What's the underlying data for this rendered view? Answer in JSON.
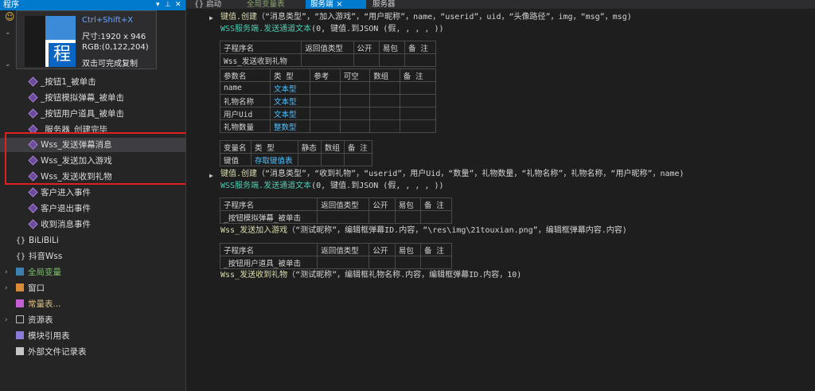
{
  "left_panel": {
    "title": "程序",
    "pin_icon": "pin-icon",
    "close_icon": "close-icon",
    "tree": [
      {
        "label": "_按钮1_被单击"
      },
      {
        "label": "_按钮模拟弹幕_被单击"
      },
      {
        "label": "_按钮用户道具_被单击"
      },
      {
        "label": "_服务器_创建完毕"
      },
      {
        "label": "Wss_发送弹幕消息"
      },
      {
        "label": "Wss_发送加入游戏"
      },
      {
        "label": "Wss_发送收到礼物"
      },
      {
        "label": "客户进入事件"
      },
      {
        "label": "客户退出事件"
      },
      {
        "label": "收到消息事件"
      },
      {
        "label": "BiLiBiLi"
      },
      {
        "label": "抖音Wss"
      },
      {
        "label": "全局变量"
      },
      {
        "label": "窗口"
      },
      {
        "label": "常量表..."
      },
      {
        "label": "资源表"
      },
      {
        "label": "模块引用表"
      },
      {
        "label": "外部文件记录表"
      }
    ]
  },
  "tooltip": {
    "hotkey": "Ctrl+Shift+X",
    "size": "尺寸:1920 x 946",
    "rgb": "RGB:(0,122,204)",
    "hint": "双击可完成复制",
    "thumb_char": "程"
  },
  "tabs": [
    {
      "label": "启动",
      "icon": "braces-icon"
    },
    {
      "label": "全局变量表"
    },
    {
      "label": "服务端",
      "close": "×"
    },
    {
      "label": "服务器"
    }
  ],
  "editor": {
    "line1": {
      "fn": "键值.创建",
      "args": "（“消息类型”，“加入游戏”，“用户昵称”，name，“userid”，uid，“头像路径”，img，“msg”，msg)"
    },
    "line2": {
      "fn": "WSS服务端.发送通道文本",
      "args": "(0, 键值.到JSON (假, , , , ))"
    },
    "table1": {
      "header": [
        "子程序名",
        "返回值类型",
        "公开",
        "易包",
        "备 注"
      ],
      "row": [
        "Wss_发送收到礼物",
        "",
        "",
        "",
        ""
      ],
      "param_header": [
        "参数名",
        "类 型",
        "参考",
        "可空",
        "数组",
        "备 注"
      ],
      "params": [
        [
          "name",
          "文本型",
          "",
          "",
          "",
          ""
        ],
        [
          "礼物名称",
          "文本型",
          "",
          "",
          "",
          ""
        ],
        [
          "用户Uid",
          "文本型",
          "",
          "",
          "",
          ""
        ],
        [
          "礼物数量",
          "整数型",
          "",
          "",
          "",
          ""
        ]
      ]
    },
    "table2": {
      "header": [
        "变量名",
        "类 型",
        "静态",
        "数组",
        "备 注"
      ],
      "row": [
        "键值",
        "存取键值表",
        "",
        "",
        ""
      ]
    },
    "line3": {
      "fn": "键值.创建",
      "args": "（“消息类型”，“收到礼物”，“userid”，用户Uid，“数量”，礼物数量，“礼物名称”，礼物名称，“用户昵称”，name)"
    },
    "line4": {
      "fn": "WSS服务端.发送通道文本",
      "args": "(0, 键值.到JSON (假, , , , ))"
    },
    "table3": {
      "header": [
        "子程序名",
        "返回值类型",
        "公开",
        "易包",
        "备 注"
      ],
      "row": [
        "_按钮模拟弹幕_被单击",
        "",
        "",
        "",
        ""
      ]
    },
    "line5": {
      "fn": "Wss_发送加入游戏",
      "args": "（“测试昵称”，编辑框弹幕ID.内容，“\\res\\img\\21touxian.png”，编辑框弹幕内容.内容)"
    },
    "table4": {
      "header": [
        "子程序名",
        "返回值类型",
        "公开",
        "易包",
        "备 注"
      ],
      "row": [
        "_按钮用户道具_被单击",
        "",
        "",
        "",
        ""
      ]
    },
    "line6": {
      "fn": "Wss_发送收到礼物",
      "args": "（“测试昵称”，编辑框礼物名称.内容，编辑框弹幕ID.内容，10)"
    }
  },
  "colors": {
    "accent": "#007acc",
    "highlight_box": "#e02020",
    "background": "#1e1e1e"
  }
}
